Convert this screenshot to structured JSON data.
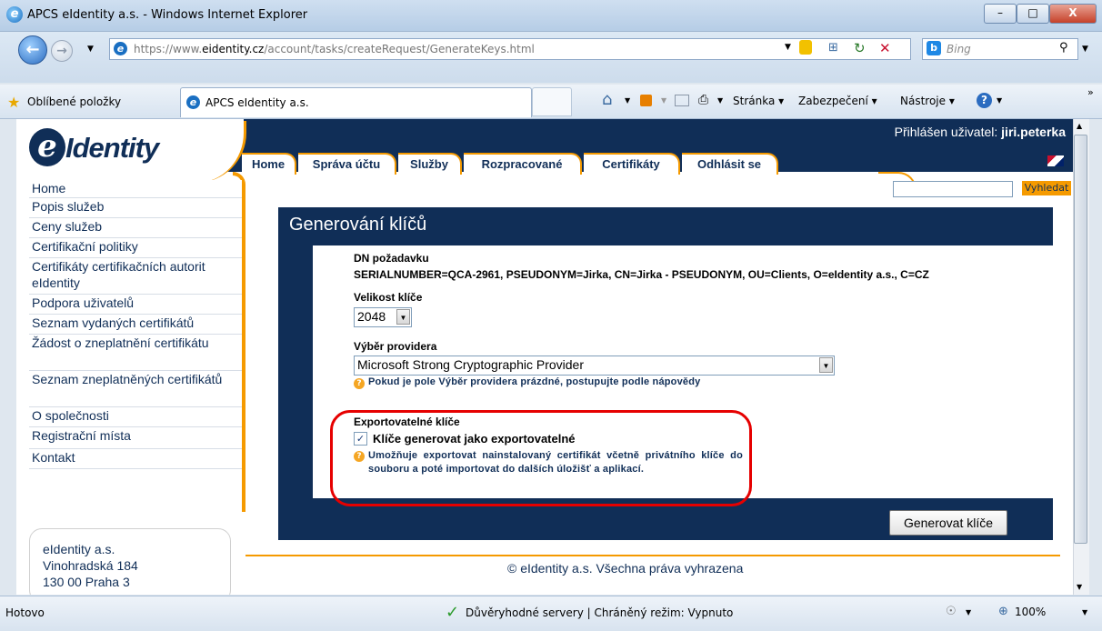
{
  "window": {
    "title": "APCS eIdentity a.s. - Windows Internet Explorer",
    "min_glyph": "–",
    "max_glyph": "□",
    "close_glyph": "X"
  },
  "address": {
    "url_prefix": "https://www.",
    "url_host": "eidentity.cz",
    "url_path": "/account/tasks/createRequest/GenerateKeys.html",
    "search_engine": "Bing"
  },
  "favorites": {
    "label": "Oblíbené položky",
    "tab_title": "APCS eIdentity a.s."
  },
  "commands": {
    "page": "Stránka ▾",
    "security": "Zabezpečení ▾",
    "tools": "Nástroje ▾"
  },
  "site": {
    "logo_text": "Identity",
    "login_prefix": "Přihlášen uživatel: ",
    "login_user": "jiri.peterka",
    "search_button": "Vyhledat",
    "nav": [
      "Home",
      "Správa účtu",
      "Služby",
      "Rozpracované",
      "Certifikáty",
      "Odhlásit se"
    ],
    "sidebar": [
      "Home",
      "Popis služeb",
      "Ceny služeb",
      "Certifikační politiky",
      "Certifikáty certifikačních autorit eIdentity",
      "Podpora uživatelů",
      "Seznam vydaných certifikátů",
      "Žádost o zneplatnění certifikátu",
      "Seznam zneplatněných certifikátů",
      "O společnosti",
      "Registrační místa",
      "Kontakt"
    ],
    "address_lines": [
      "eIdentity a.s.",
      "Vinohradská 184",
      "130 00 Praha 3"
    ],
    "footer": "© eIdentity a.s. Všechna práva vyhrazena"
  },
  "dialog": {
    "title": "Generování klíčů",
    "dn_label": "DN požadavku",
    "dn_value": "SERIALNUMBER=QCA-2961, PSEUDONYM=Jirka, CN=Jirka - PSEUDONYM, OU=Clients, O=eIdentity a.s., C=CZ",
    "key_size_label": "Velikost klíče",
    "key_size_value": "2048",
    "provider_label": "Výběr providera",
    "provider_value": "Microsoft Strong Cryptographic Provider",
    "provider_hint": "Pokud je pole Výběr providera prázdné, postupujte podle nápovědy",
    "export_label": "Exportovatelné klíče",
    "export_checkbox_label": "Klíče generovat jako exportovatelné",
    "export_checked": true,
    "export_hint": "Umožňuje exportovat nainstalovaný certifikát včetně privátního klíče do souboru a poté importovat do dalších úložišť a aplikací.",
    "generate_button": "Generovat klíče"
  },
  "status": {
    "left": "Hotovo",
    "zone": "Důvěryhodné servery | Chráněný režim: Vypnuto",
    "zoom": "100%"
  }
}
